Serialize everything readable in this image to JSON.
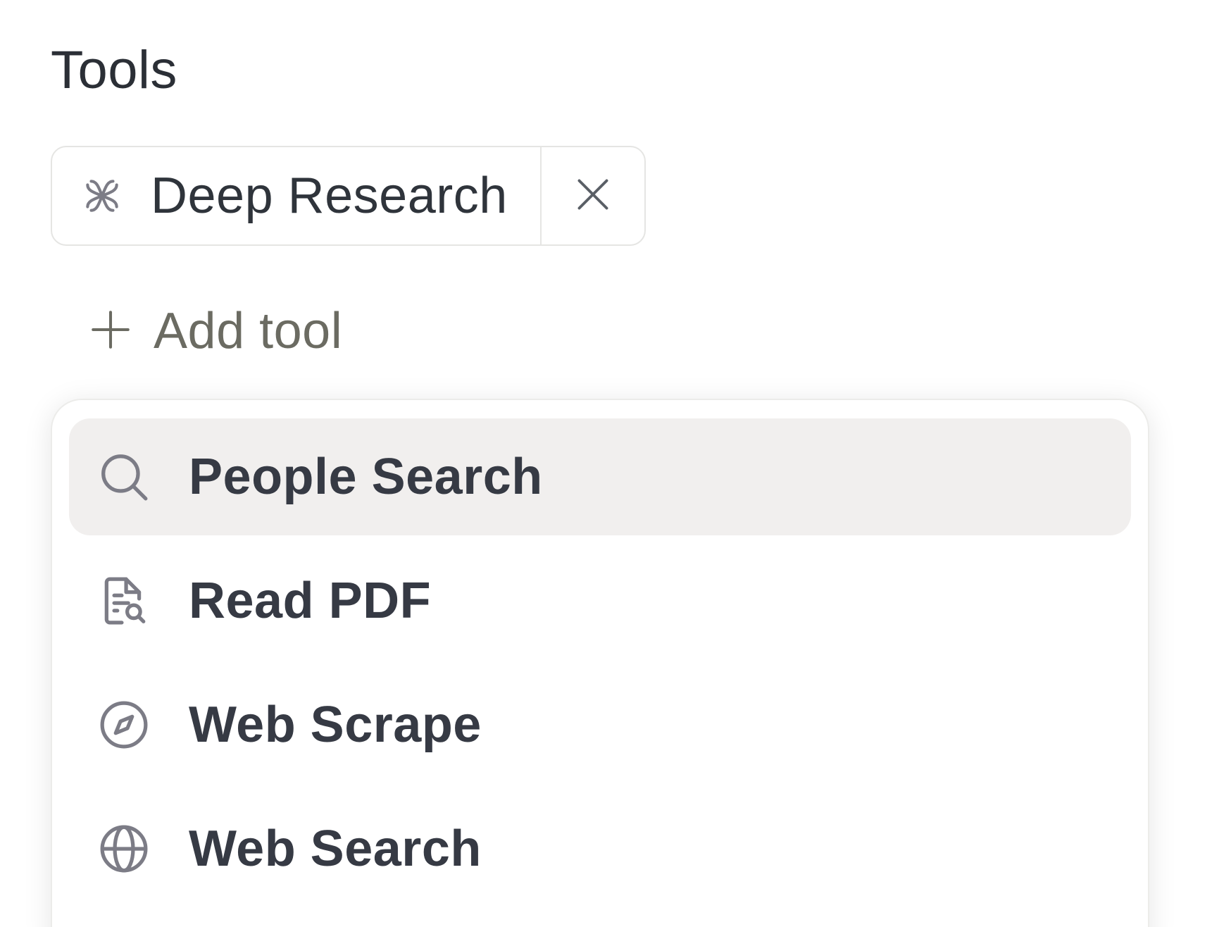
{
  "section": {
    "title": "Tools"
  },
  "selected_tool": {
    "label": "Deep Research",
    "icon": "deep-research-icon",
    "remove_icon": "close-icon"
  },
  "add_tool": {
    "label": "Add tool",
    "icon": "plus-icon"
  },
  "menu": {
    "items": [
      {
        "label": "People Search",
        "icon": "search-icon",
        "highlighted": true
      },
      {
        "label": "Read PDF",
        "icon": "document-search-icon",
        "highlighted": false
      },
      {
        "label": "Web Scrape",
        "icon": "compass-icon",
        "highlighted": false
      },
      {
        "label": "Web Search",
        "icon": "globe-icon",
        "highlighted": false
      }
    ]
  },
  "colors": {
    "text_primary": "#2b2f36",
    "text_muted": "#6b6b62",
    "icon_gray": "#7c7c86",
    "highlight_bg": "#f1efee",
    "border": "#e5e5e3"
  }
}
